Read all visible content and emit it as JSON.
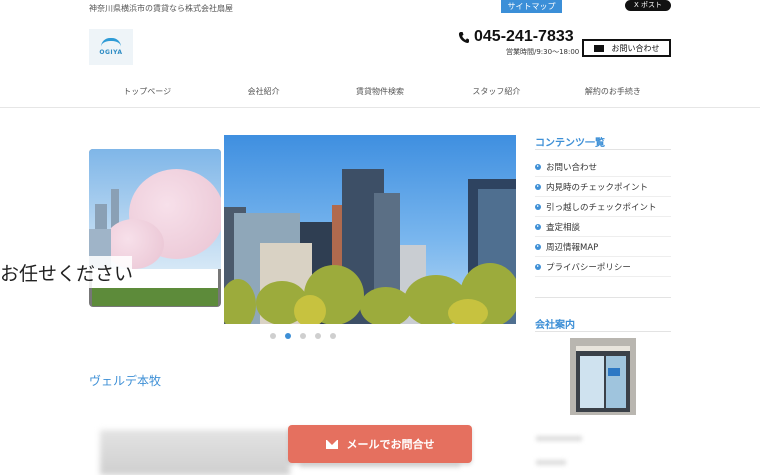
{
  "header": {
    "tagline": "神奈川県横浜市の賃貸なら株式会社扇屋",
    "sitemap_label": "サイトマップ",
    "x_post_label": "X ポスト",
    "logo_text": "OGIYA",
    "phone_number": "045-241-7833",
    "hours": "営業時間/9:30～18:00",
    "contact_label": "お問い合わせ"
  },
  "nav": {
    "items": [
      {
        "label": "トップページ"
      },
      {
        "label": "会社紹介"
      },
      {
        "label": "賃貸物件検索"
      },
      {
        "label": "スタッフ紹介"
      },
      {
        "label": "解約のお手続き"
      }
    ]
  },
  "slider": {
    "prev_caption": "お任せください",
    "dots_count": 5,
    "active_dot": 2
  },
  "main": {
    "section_title": "ヴェルデ本牧",
    "mail_cta_label": "メールでお問合せ"
  },
  "sidebar": {
    "contents_title": "コンテンツ一覧",
    "items": [
      {
        "label": "お問い合わせ"
      },
      {
        "label": "内見時のチェックポイント"
      },
      {
        "label": "引っ越しのチェックポイント"
      },
      {
        "label": "査定相談"
      },
      {
        "label": "周辺情報MAP"
      },
      {
        "label": "プライバシーポリシー"
      }
    ],
    "company_title": "会社案内"
  },
  "colors": {
    "accent": "#3d8fd6",
    "cta": "#e5705f"
  }
}
